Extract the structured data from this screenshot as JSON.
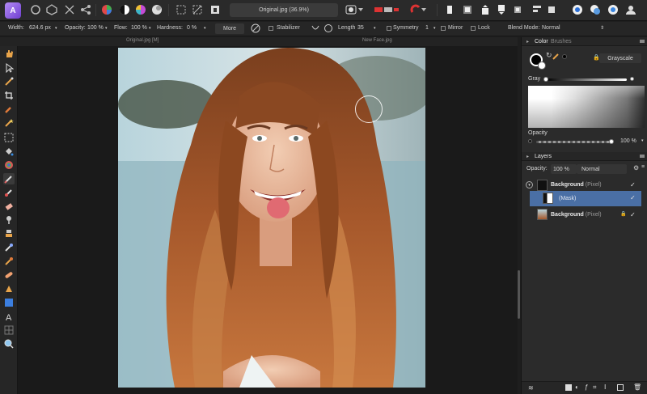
{
  "app": {
    "logo_glyph": "A",
    "accent": "#8a5ce6"
  },
  "document": {
    "tab_title": "Original.jpg (36.9%)"
  },
  "doc_strip": {
    "left_name": "Original.jpg [M]",
    "right_name": "New Face.jpg"
  },
  "context_bar": {
    "width_label": "Width:",
    "width_value": "624.6 px",
    "opacity_label": "Opacity:",
    "opacity_value": "100 %",
    "flow_label": "Flow:",
    "flow_value": "100 %",
    "hardness_label": "Hardness:",
    "hardness_value": "0 %",
    "more_label": "More",
    "stabilizer_label": "Stabilizer",
    "length_label": "Length",
    "length_value": "35",
    "symmetry_label": "Symmetry",
    "symmetry_value": "1",
    "mirror_label": "Mirror",
    "lock_label": "Lock",
    "blend_label": "Blend Mode:",
    "blend_value": "Normal"
  },
  "color_panel": {
    "tab_color": "Color",
    "tab_brushes": "Brushes",
    "mode_value": "Grayscale",
    "gray_label": "Gray",
    "opacity_label": "Opacity",
    "opacity_value": "100 %"
  },
  "layers_panel": {
    "tab_label": "Layers",
    "opacity_label": "Opacity:",
    "opacity_value": "100 %",
    "blend_value": "Normal",
    "layers": [
      {
        "name": "Background",
        "type": "(Pixel)"
      },
      {
        "name": "",
        "type": "(Mask)"
      },
      {
        "name": "Background",
        "type": "(Pixel)"
      }
    ]
  },
  "checks": {
    "mark": "✓"
  }
}
